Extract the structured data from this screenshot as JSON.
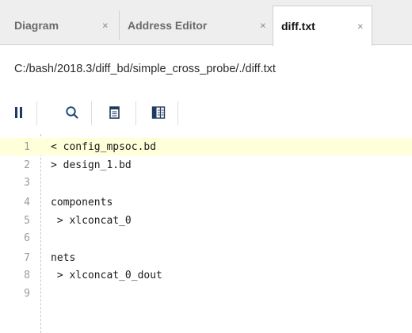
{
  "tabs": [
    {
      "label": "Diagram",
      "close": "×",
      "active": false
    },
    {
      "label": "Address Editor",
      "close": "×",
      "active": false
    },
    {
      "label": "diff.txt",
      "close": "×",
      "active": true
    }
  ],
  "path": "C:/bash/2018.3/diff_bd/simple_cross_probe/./diff.txt",
  "toolbar": {
    "icons": [
      "pause-icon",
      "search-icon",
      "copy-icon",
      "columns-icon"
    ]
  },
  "editor": {
    "highlight_color": "#ffffd9",
    "lines": [
      {
        "num": "1",
        "text": "< config_mpsoc.bd"
      },
      {
        "num": "2",
        "text": "> design_1.bd"
      },
      {
        "num": "3",
        "text": ""
      },
      {
        "num": "4",
        "text": "components"
      },
      {
        "num": "5",
        "text": " > xlconcat_0"
      },
      {
        "num": "6",
        "text": ""
      },
      {
        "num": "7",
        "text": "nets"
      },
      {
        "num": "8",
        "text": " > xlconcat_0_dout"
      },
      {
        "num": "9",
        "text": ""
      }
    ]
  }
}
